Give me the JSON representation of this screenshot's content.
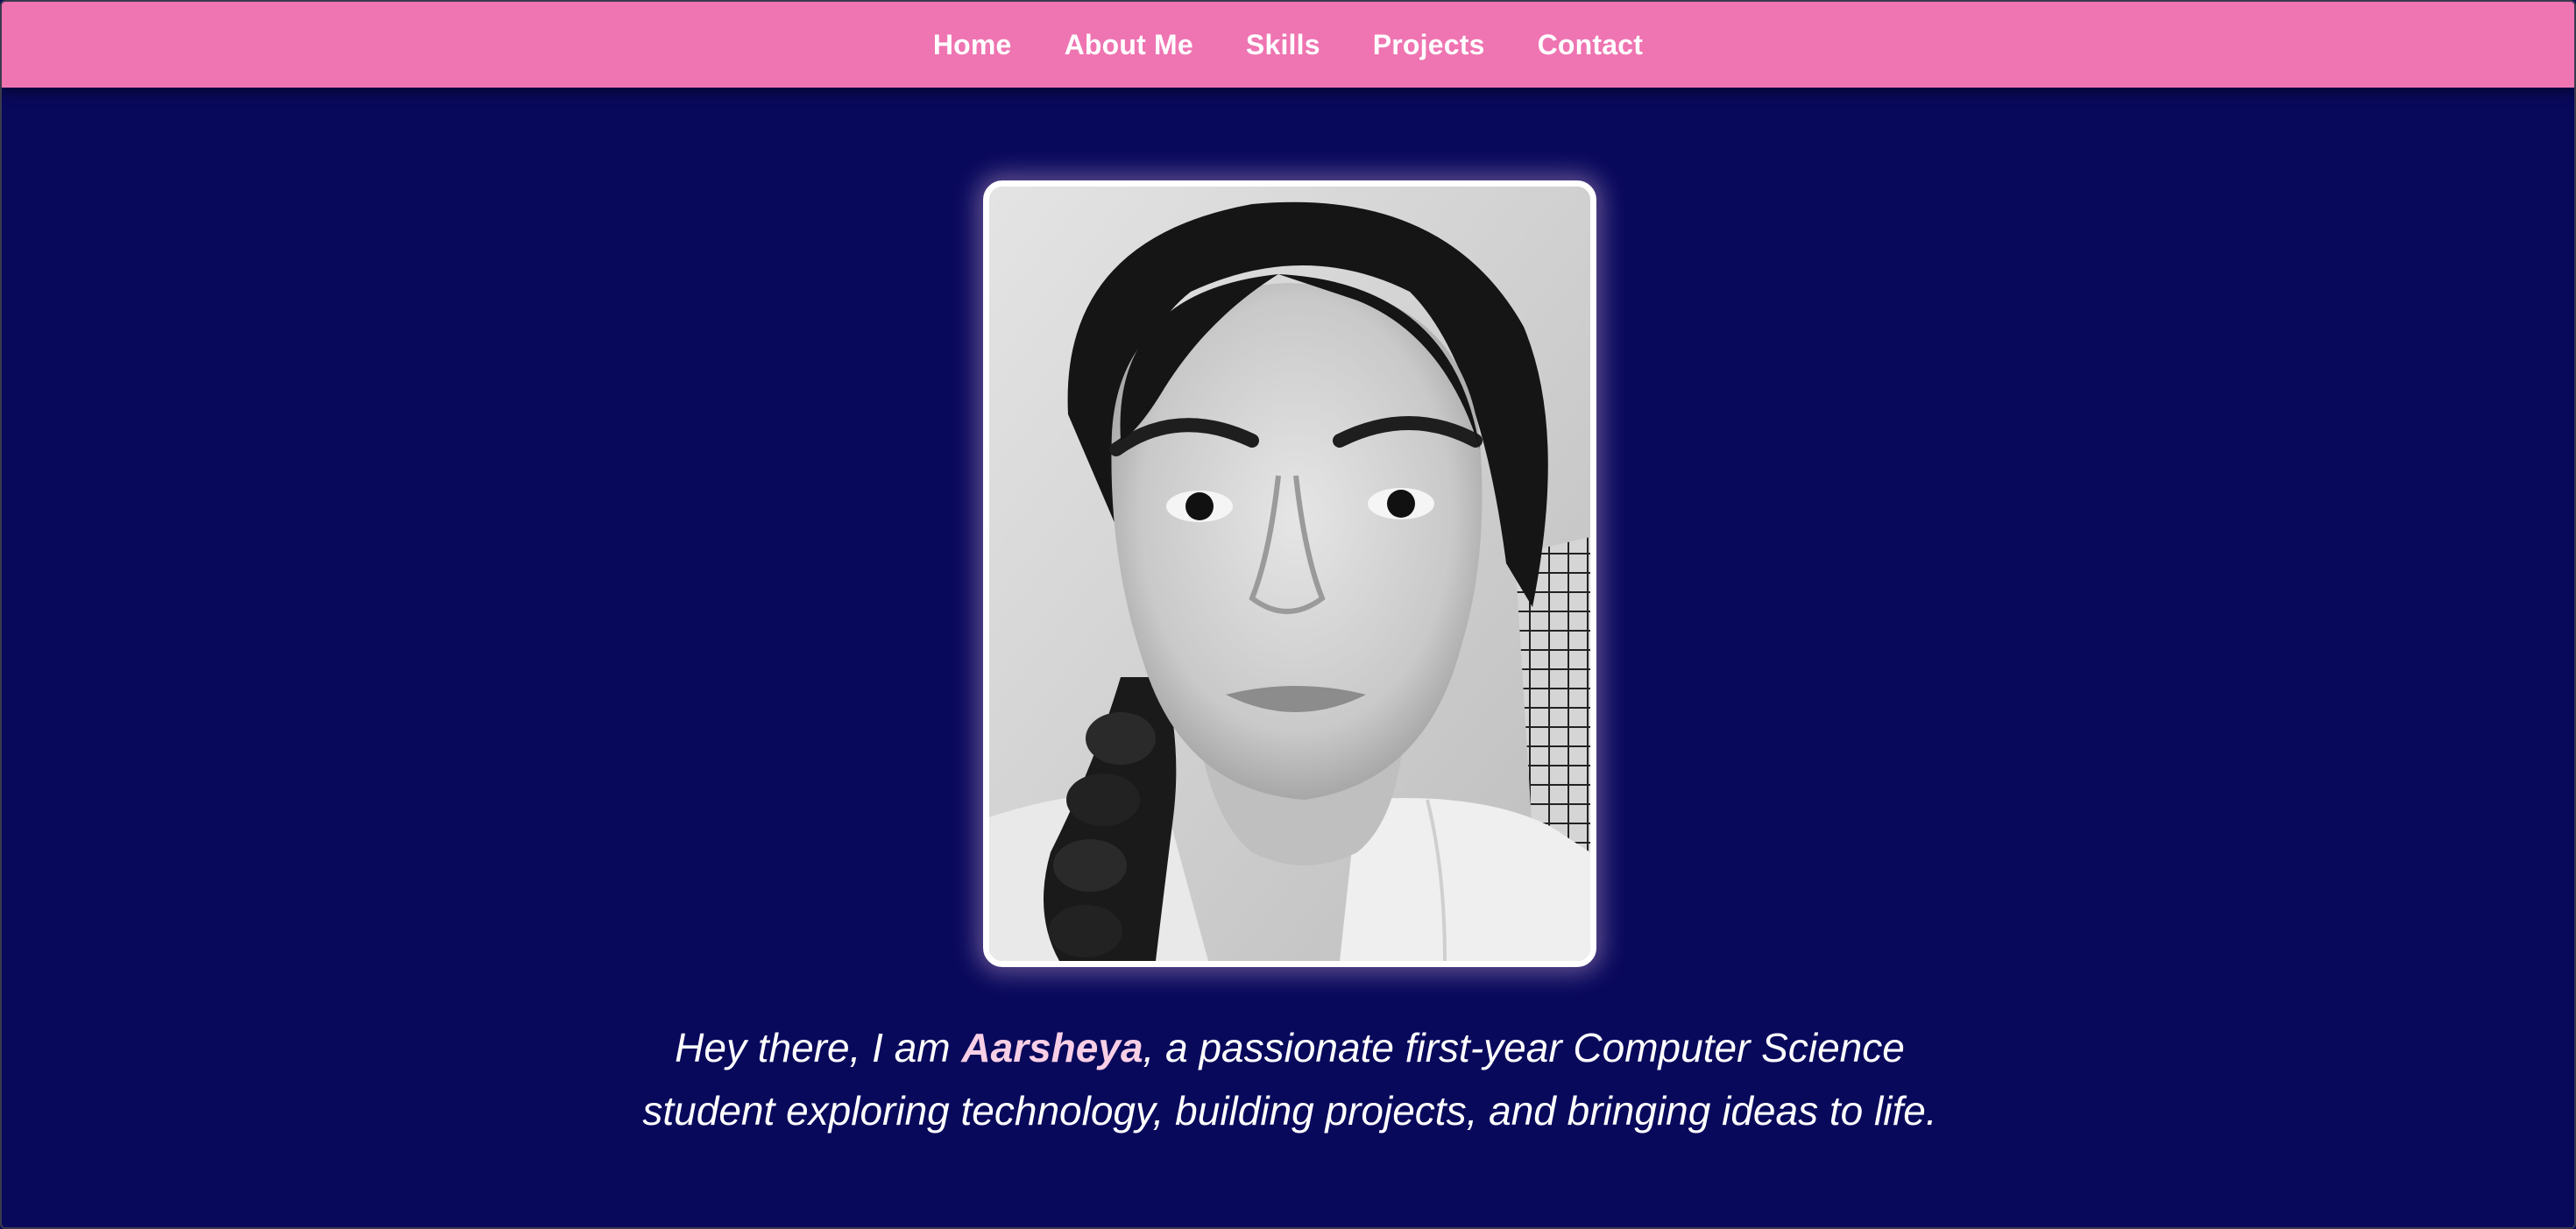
{
  "nav": {
    "items": [
      {
        "label": "Home"
      },
      {
        "label": "About Me"
      },
      {
        "label": "Skills"
      },
      {
        "label": "Projects"
      },
      {
        "label": "Contact"
      }
    ]
  },
  "hero": {
    "photo_icon": "profile-photo",
    "intro_before": "Hey there, I am ",
    "name": "Aarsheya",
    "intro_after": ", a passionate first-year Computer Science student exploring technology, building projects, and bringing ideas to life."
  },
  "colors": {
    "background": "#09095c",
    "navbar": "#ef74b2",
    "name_highlight": "#f9cfe6",
    "text": "#ffffff"
  }
}
